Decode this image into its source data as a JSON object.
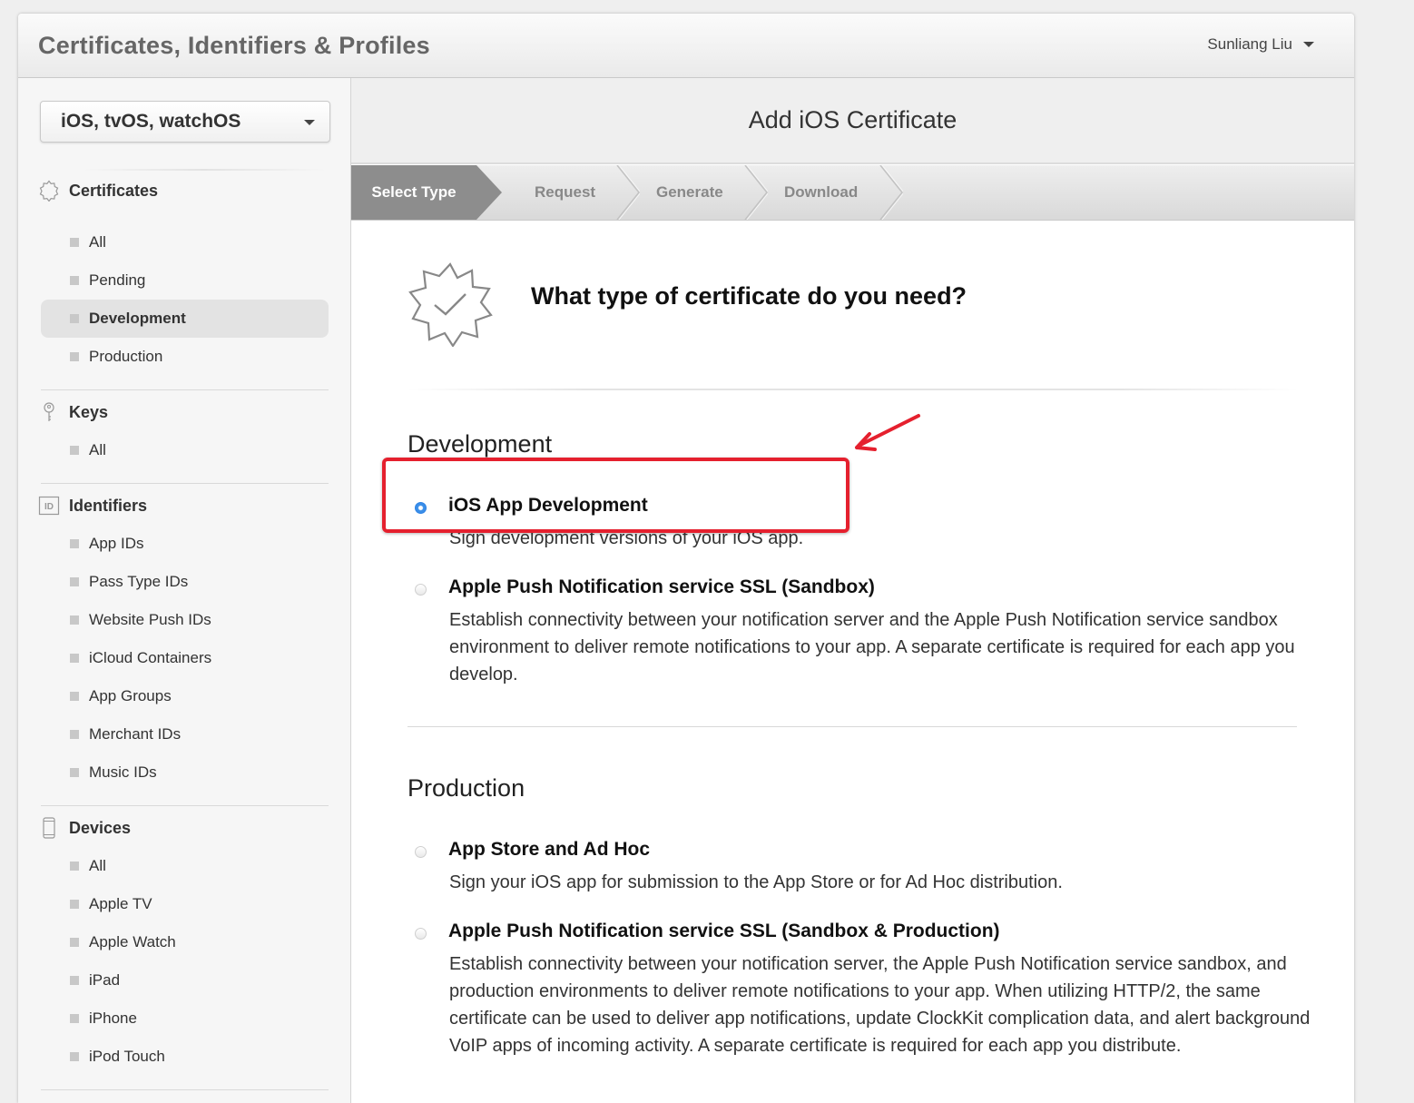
{
  "app": {
    "title": "Certificates, Identifiers & Profiles",
    "user_name": "Sunliang Liu"
  },
  "sidebar": {
    "platform": "iOS, tvOS, watchOS",
    "sections": [
      {
        "title": "Certificates",
        "icon": "certificate-badge-icon",
        "items": [
          "All",
          "Pending",
          "Development",
          "Production"
        ],
        "active": "Development"
      },
      {
        "title": "Keys",
        "icon": "key-icon",
        "items": [
          "All"
        ]
      },
      {
        "title": "Identifiers",
        "icon": "id-icon",
        "items": [
          "App IDs",
          "Pass Type IDs",
          "Website Push IDs",
          "iCloud Containers",
          "App Groups",
          "Merchant IDs",
          "Music IDs"
        ]
      },
      {
        "title": "Devices",
        "icon": "device-phone-icon",
        "items": [
          "All",
          "Apple TV",
          "Apple Watch",
          "iPad",
          "iPhone",
          "iPod Touch"
        ]
      }
    ]
  },
  "main": {
    "header": "Add iOS Certificate",
    "steps": [
      "Select Type",
      "Request",
      "Generate",
      "Download"
    ],
    "active_step": "Select Type",
    "question": "What type of certificate do you need?",
    "groups": [
      {
        "title": "Development",
        "options": [
          {
            "title": "iOS App Development",
            "desc": "Sign development versions of your iOS app.",
            "checked": true
          },
          {
            "title": "Apple Push Notification service SSL (Sandbox)",
            "desc": "Establish connectivity between your notification server and the Apple Push Notification service sandbox environment to deliver remote notifications to your app. A separate certificate is required for each app you develop.",
            "checked": false
          }
        ]
      },
      {
        "title": "Production",
        "options": [
          {
            "title": "App Store and Ad Hoc",
            "desc": "Sign your iOS app for submission to the App Store or for Ad Hoc distribution.",
            "checked": false
          },
          {
            "title": "Apple Push Notification service SSL (Sandbox & Production)",
            "desc": "Establish connectivity between your notification server, the Apple Push Notification service sandbox, and production environments to deliver remote notifications to your app. When utilizing HTTP/2, the same certificate can be used to deliver app notifications, update ClockKit complication data, and alert background VoIP apps of incoming activity. A separate certificate is required for each app you distribute.",
            "checked": false
          }
        ]
      }
    ]
  },
  "annotation": {
    "color": "#e5202e"
  }
}
